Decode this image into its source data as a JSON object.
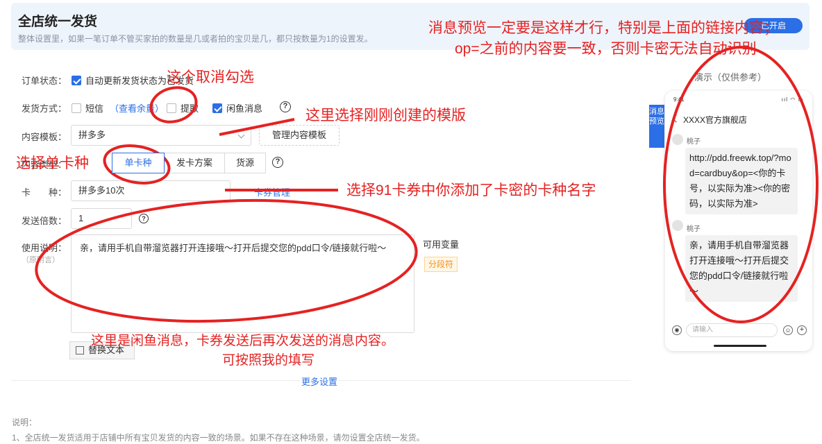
{
  "banner": {
    "title": "全店统一发货",
    "desc": "整体设置里，如果一笔订单不管买家拍的数量是几或者拍的宝贝是几，都只按数量为1的设置发。",
    "toggle_label": "已开启"
  },
  "form": {
    "order_status_label": "订单状态：",
    "order_status_option": "自动更新发货状态为已发货",
    "ship_method_label": "发货方式：",
    "ship_sms": "短信",
    "ship_sms_link": "（查看余量）",
    "ship_extract": "提取",
    "ship_xianyu": "闲鱼消息",
    "template_label": "内容模板：",
    "template_value": "拼多多",
    "manage_template": "管理内容模板",
    "type_label": "内容类型：",
    "type_options": [
      "单卡种",
      "发卡方案",
      "货源"
    ],
    "card_label": "卡　　种：",
    "card_value": "拼多多10次",
    "card_manage": "卡券管理",
    "multiple_label": "发送倍数：",
    "multiple_value": "1",
    "usage_label": "使用说明：",
    "usage_sub": "（原附言）",
    "usage_text": "亲，请用手机自带溜览器打开连接哦～打开后提交您的pdd口令/链接就行啦～",
    "var_title": "可用变量",
    "var_tag": "分段符",
    "replace_btn": "替换文本",
    "more": "更多设置"
  },
  "notes": {
    "title": "说明：",
    "line1": "1、全店统一发货适用于店铺中所有宝贝发货的内容一致的场景。如果不存在这种场景，请勿设置全店统一发货。"
  },
  "preview": {
    "side_tab": "消息预览",
    "caption": "演示（仅供参考）",
    "status_time": "9:41",
    "status_icons": "ııl ◠ ▭",
    "shop": "XXXX官方旗舰店",
    "sender1": "桃子",
    "msg1": "http://pdd.freewk.top/?mod=cardbuy&op=<你的卡号，以实际为准><你的密码，以实际为准>",
    "sender2": "桃子",
    "msg2": "亲，请用手机自带溜览器打开连接哦～打开后提交您的pdd口令/链接就行啦～",
    "input_placeholder": "请输入",
    "voice_glyph": "◉",
    "emoji_glyph": "☺",
    "plus_glyph": "+"
  },
  "annotations": {
    "top_right_1": "消息预览一定要是这样才行，特别是上面的链接内容；",
    "top_right_2": "op=之前的内容要一致，否则卡密无法自动识别",
    "uncheck": "这个取消勾选",
    "choose_template": "这里选择刚刚创建的模版",
    "choose_single": "选择单卡种",
    "choose_card": "选择91卡券中你添加了卡密的卡种名字",
    "xianyu_1": "这里是闲鱼消息，卡券发送后再次发送的消息内容。",
    "xianyu_2": "可按照我的填写"
  },
  "colors": {
    "accent": "#2b6fe6",
    "annotation_red": "#e52222",
    "tag_orange": "#fa8c16"
  }
}
